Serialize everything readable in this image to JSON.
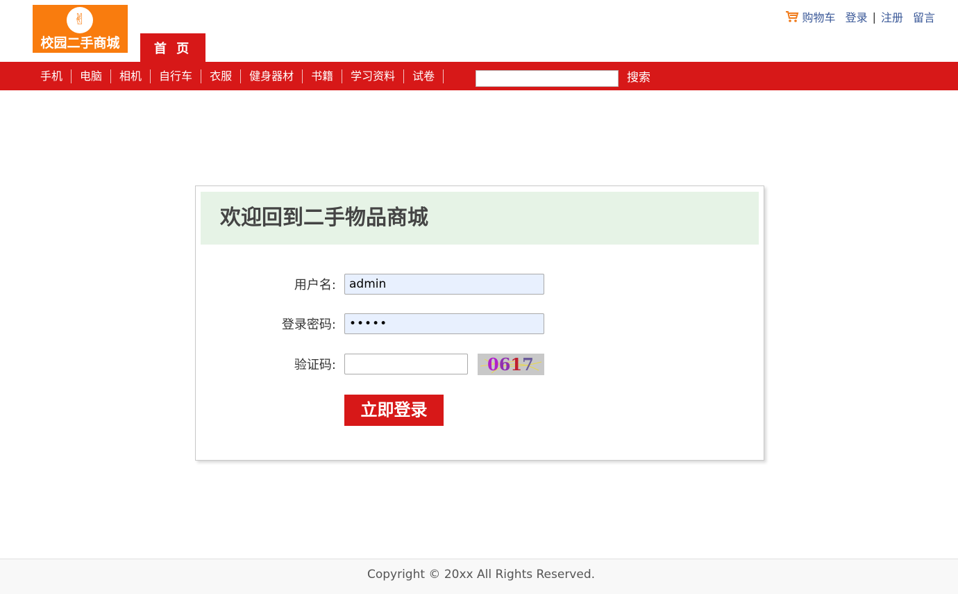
{
  "brand": {
    "logo_text": "校园二手商城",
    "logo_color": "#f97c0e"
  },
  "header": {
    "home_tab": "首 页",
    "links": {
      "cart": "购物车",
      "login": "登录",
      "separator": "|",
      "register": "注册",
      "message": "留言"
    }
  },
  "nav": {
    "items": [
      "手机",
      "电脑",
      "相机",
      "自行车",
      "衣服",
      "健身器材",
      "书籍",
      "学习资料",
      "试卷"
    ],
    "search_value": "",
    "search_button": "搜索",
    "bar_color": "#d71818"
  },
  "login": {
    "title": "欢迎回到二手物品商城",
    "username_label": "用户名:",
    "username_value": "admin",
    "password_label": "登录密码:",
    "password_value": "•••••",
    "captcha_label": "验证码:",
    "captcha_value": "",
    "captcha_code": "0617",
    "submit": "立即登录"
  },
  "footer": {
    "copyright": "Copyright © 20xx All Rights Reserved."
  }
}
